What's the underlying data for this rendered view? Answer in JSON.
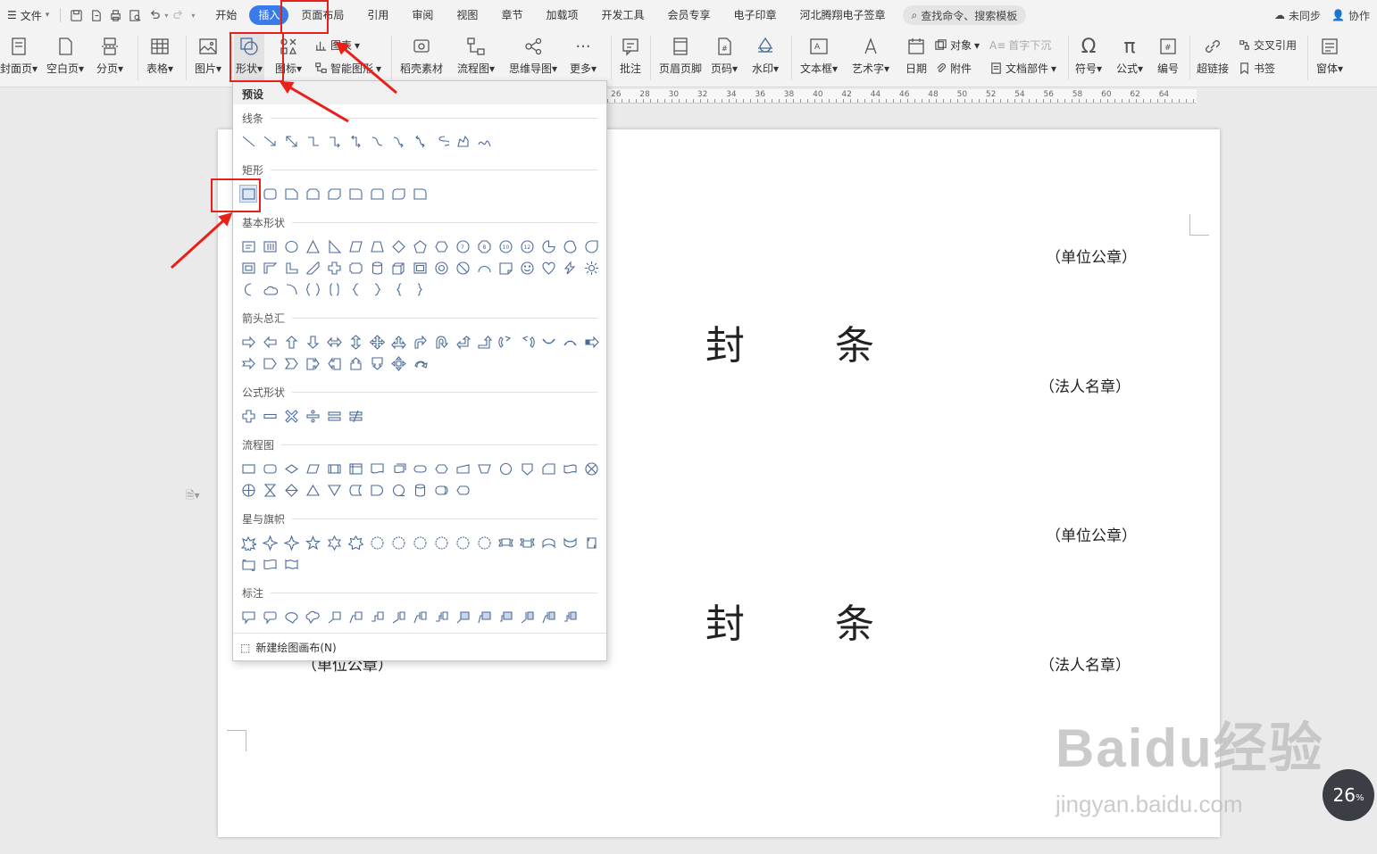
{
  "menu": {
    "file": "文件",
    "tabs": [
      "开始",
      "插入",
      "页面布局",
      "引用",
      "审阅",
      "视图",
      "章节",
      "加载项",
      "开发工具",
      "会员专享",
      "电子印章",
      "河北腾翔电子签章"
    ],
    "active_tab": "插入",
    "search": "查找命令、搜索模板",
    "sync": "未同步",
    "collab": "协作"
  },
  "ribbon": {
    "cover": "封面页",
    "blank": "空白页",
    "pagebreak": "分页",
    "table": "表格",
    "picture": "图片",
    "shape": "形状",
    "icon": "图标",
    "chart": "图表",
    "smartart": "智能图形",
    "material": "稻壳素材",
    "flowchart": "流程图",
    "mindmap": "思维导图",
    "more": "更多",
    "comment": "批注",
    "headerfooter": "页眉页脚",
    "pagenum": "页码",
    "watermark": "水印",
    "textbox": "文本框",
    "wordart": "艺术字",
    "date": "日期",
    "object": "对象",
    "attachment": "附件",
    "dropcap": "首字下沉",
    "docpart": "文档部件",
    "symbol": "符号",
    "formula": "公式",
    "numbering": "编号",
    "hyperlink": "超链接",
    "crossref": "交叉引用",
    "bookmark": "书签",
    "window": "窗体"
  },
  "ruler_numbers": [
    "26",
    "28",
    "30",
    "32",
    "34",
    "36",
    "38",
    "40",
    "42",
    "44",
    "46",
    "48",
    "50",
    "52",
    "54",
    "56",
    "58",
    "60",
    "62",
    "64"
  ],
  "document": {
    "seal_unit": "（单位公章）",
    "seal_legal": "（法人名章）",
    "feng": "封",
    "tiao": "条",
    "partial_seal": "（单位公章）"
  },
  "shapes_panel": {
    "header": "预设",
    "sections": {
      "lines": "线条",
      "rect": "矩形",
      "basic": "基本形状",
      "arrows": "箭头总汇",
      "formula": "公式形状",
      "flow": "流程图",
      "stars": "星与旗帜",
      "callouts": "标注"
    },
    "footer": "新建绘图画布(N)"
  },
  "watermark": {
    "brand": "Baidu经验",
    "url": "jingyan.baidu.com"
  },
  "zoom": {
    "value": "26",
    "unit": "%"
  }
}
